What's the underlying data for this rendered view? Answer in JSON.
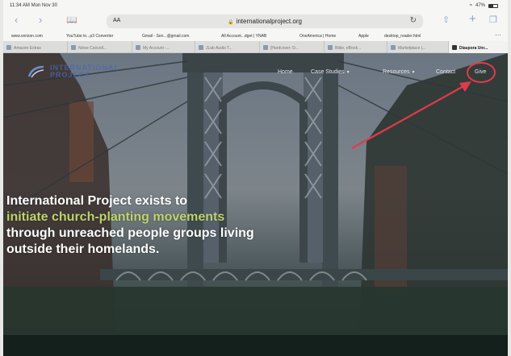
{
  "status_bar": {
    "time_date": "11:34 AM  Mon Nov 30",
    "battery": "47%"
  },
  "browser": {
    "text_size_label": "AA",
    "url": "internationalproject.org",
    "favorites": [
      "www.verizon.com",
      "YouTube to...p3 Converter",
      "Gmail - Sen...@gmail.com",
      "All Account...dget | YNAB",
      "OneAmerica | Home",
      "Apple",
      "desktop_reader.html"
    ],
    "tabs": [
      "Amazon Extras",
      "Noise Cancell...",
      "My Account -...",
      "JLab Audio T...",
      "[Hardcover: D...",
      "Bible, eBook...",
      "Marketplace |...",
      "Diaspora Unr..."
    ]
  },
  "site": {
    "logo_line1": "INTERNATIONAL",
    "logo_line2": "PROJECT",
    "nav": {
      "home": "Home",
      "case_studies": "Case Studies",
      "resources": "Resources",
      "contact": "Contact",
      "give": "Give"
    },
    "hero": {
      "line1": "International Project exists to",
      "line2_highlight": "initiate church-planting movements",
      "line3": "through unreached people groups living",
      "line4": "outside their homelands."
    }
  },
  "colors": {
    "annotation": "#e23a4a",
    "highlight_text": "#bfd36a",
    "logo_blue": "#4a68b0"
  }
}
